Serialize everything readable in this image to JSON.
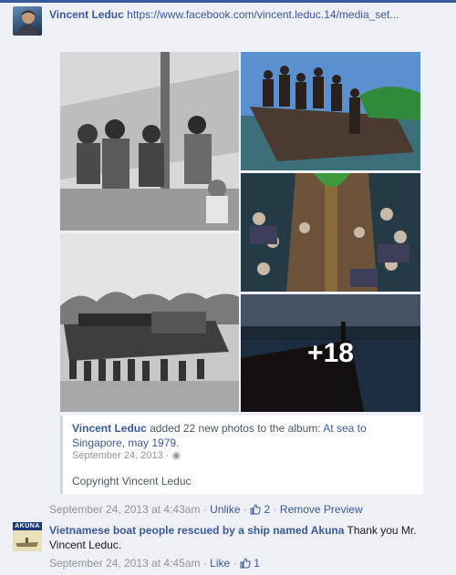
{
  "post": {
    "author": "Vincent Leduc",
    "link": "https://www.facebook.com/vincent.leduc.14/media_set...",
    "more_count": "+18"
  },
  "shared": {
    "author": "Vincent Leduc",
    "action": " added 22 new photos to the album: ",
    "album": "At sea to Singapore, may 1979.",
    "date": "September 24, 2013 · ",
    "caption": "Copyright Vincent Leduc"
  },
  "actions": {
    "timestamp": "September 24, 2013 at 4:43am",
    "unlike": "Unlike",
    "like_count": "2",
    "remove_preview": "Remove Preview"
  },
  "comment": {
    "avatar_label": "AKUNA",
    "author": "Vietnamese boat people rescued by a ship named Akuna",
    "text": " Thank you Mr. Vincent Leduc.",
    "timestamp": "September 24, 2013 at 4:45am",
    "like": "Like",
    "like_count": "1"
  },
  "colors": {
    "link": "#3b5998",
    "muted": "#90949c",
    "background": "#eef0f5"
  }
}
